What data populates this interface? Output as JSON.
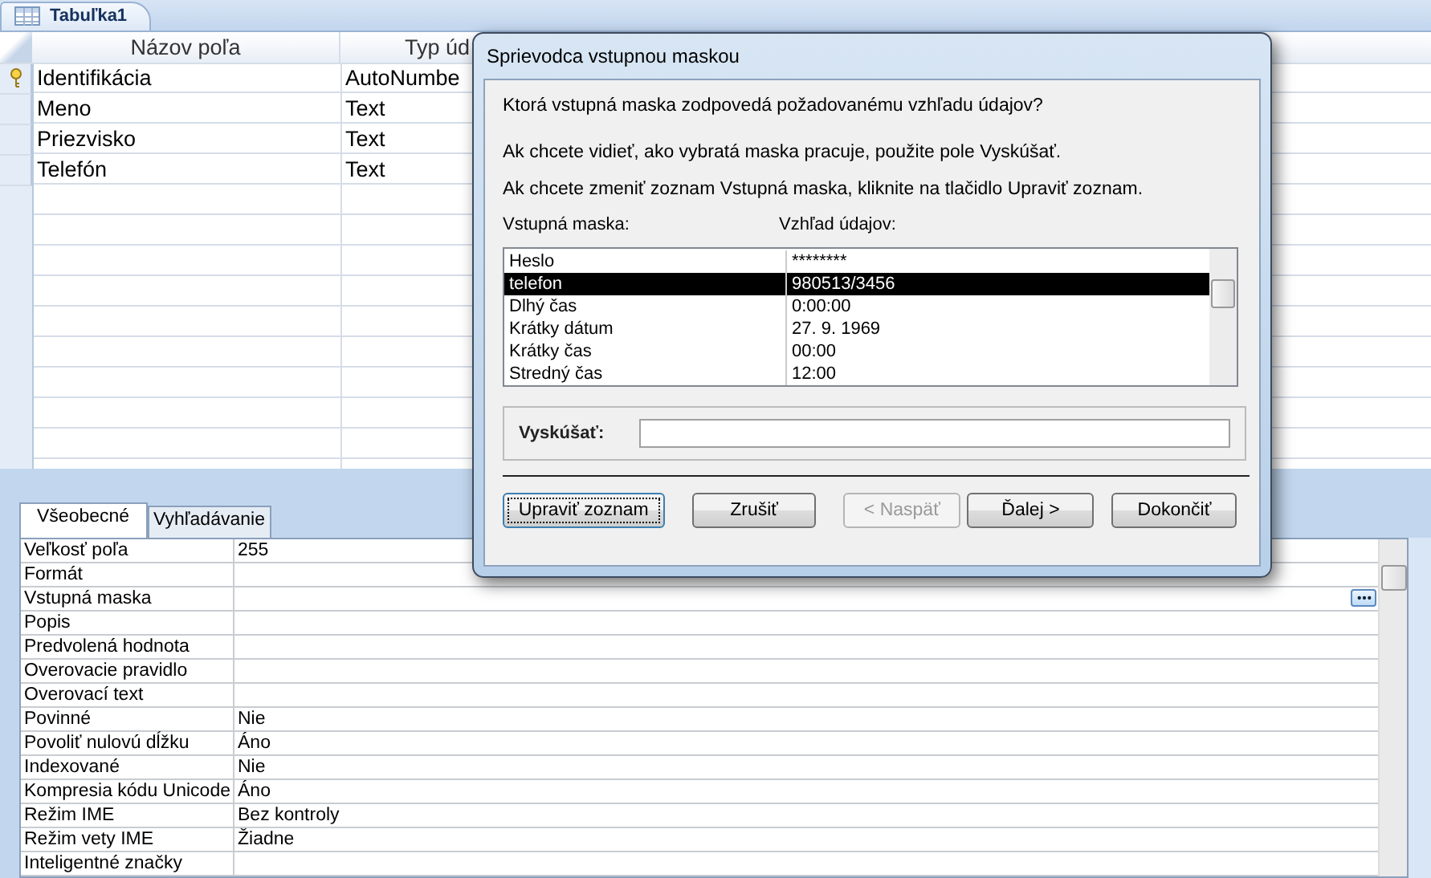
{
  "document_tab": {
    "label": "Tabuľka1",
    "selected": true
  },
  "design_grid": {
    "columns": [
      "Názov poľa",
      "Typ úd"
    ],
    "rows": [
      {
        "primary_key": true,
        "cells": [
          "Identifikácia",
          "AutoNumbe"
        ]
      },
      {
        "primary_key": false,
        "cells": [
          "Meno",
          "Text"
        ]
      },
      {
        "primary_key": false,
        "cells": [
          "Priezvisko",
          "Text"
        ]
      },
      {
        "primary_key": false,
        "cells": [
          "Telefón",
          "Text"
        ]
      }
    ]
  },
  "property_tabs": [
    {
      "label": "Všeobecné",
      "selected": true
    },
    {
      "label": "Vyhľadávanie",
      "selected": false
    }
  ],
  "properties": [
    {
      "name": "Veľkosť poľa",
      "value": "255",
      "builder_button": false
    },
    {
      "name": "Formát",
      "builder_button": false
    },
    {
      "name": "Vstupná maska",
      "builder_button": true
    },
    {
      "name": "Popis",
      "builder_button": false
    },
    {
      "name": "Predvolená hodnota",
      "builder_button": false
    },
    {
      "name": "Overovacie pravidlo",
      "builder_button": false
    },
    {
      "name": "Overovací text",
      "builder_button": false
    },
    {
      "name": "Povinné",
      "value": "Nie",
      "builder_button": false
    },
    {
      "name": "Povoliť nulovú dĺžku",
      "value": "Áno",
      "builder_button": false
    },
    {
      "name": "Indexované",
      "value": "Nie",
      "builder_button": false
    },
    {
      "name": "Kompresia kódu Unicode",
      "value": "Áno",
      "builder_button": false
    },
    {
      "name": "Režim IME",
      "value": "Bez kontroly",
      "builder_button": false
    },
    {
      "name": "Režim vety IME",
      "value": "Žiadne",
      "builder_button": false
    },
    {
      "name": "Inteligentné značky",
      "builder_button": false
    }
  ],
  "dialog": {
    "title": "Sprievodca vstupnou maskou",
    "question": "Ktorá vstupná maska zodpovedá požadovanému vzhľadu údajov?",
    "hints": [
      "Ak chcete vidieť, ako vybratá maska pracuje, použite pole Vyskúšať.",
      "Ak chcete zmeniť zoznam Vstupná maska, kliknite na tlačidlo Upraviť zoznam."
    ],
    "list_headers": [
      "Vstupná maska:",
      "Vzhľad údajov:"
    ],
    "masks": [
      {
        "name": "Heslo",
        "preview": "********",
        "selected": false
      },
      {
        "name": "telefon",
        "preview": "980513/3456",
        "selected": true
      },
      {
        "name": "Dlhý čas",
        "preview": "0:00:00",
        "selected": false
      },
      {
        "name": "Krátky dátum",
        "preview": "27. 9. 1969",
        "selected": false
      },
      {
        "name": "Krátky čas",
        "preview": "00:00",
        "selected": false
      },
      {
        "name": "Stredný čas",
        "preview": "12:00",
        "selected": false
      }
    ],
    "try_label": "Vyskúšať:",
    "buttons": [
      {
        "label": "Upraviť zoznam",
        "disabled": false,
        "focused": true
      },
      {
        "label": "Zrušiť",
        "disabled": false,
        "focused": false
      },
      {
        "label": "< Naspäť",
        "disabled": true,
        "focused": false
      },
      {
        "label": "Ďalej >",
        "disabled": false,
        "focused": false
      },
      {
        "label": "Dokončiť",
        "disabled": false,
        "focused": false
      }
    ]
  }
}
